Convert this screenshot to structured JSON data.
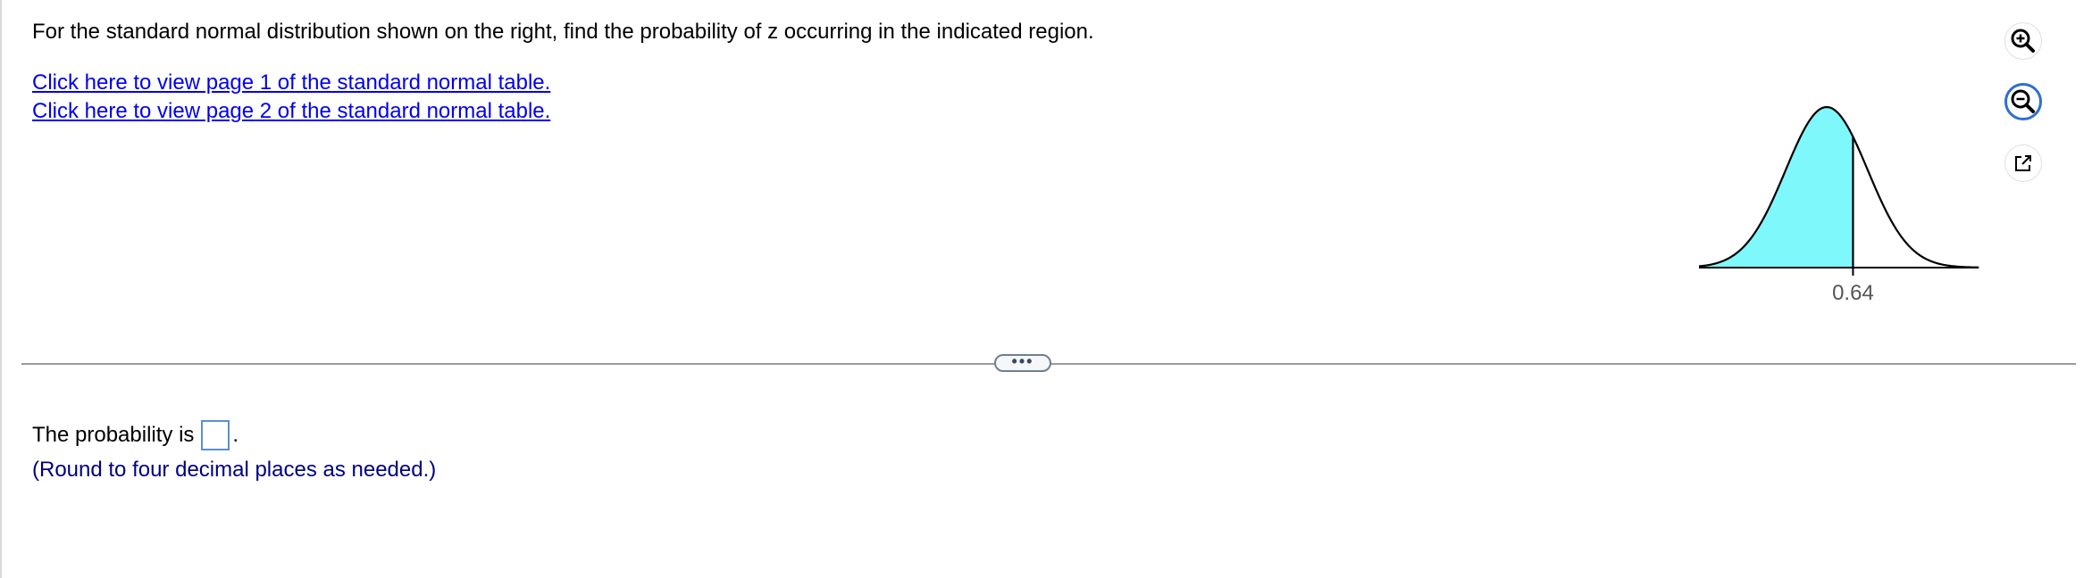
{
  "question": {
    "text": "For the standard normal distribution shown on the right, find the probability of z occurring in the indicated region."
  },
  "links": [
    {
      "label": "Click here to view page 1 of the standard normal table."
    },
    {
      "label": "Click here to view page 2 of the standard normal table."
    }
  ],
  "figure": {
    "z_value_label": "0.64",
    "z_value": 0.64,
    "shaded_region": "left of z",
    "fill_color": "#7ff8fb",
    "curve_color": "#000000"
  },
  "toolbar": {
    "icons": [
      "zoom-in-icon",
      "zoom-out-icon",
      "popout-icon"
    ]
  },
  "divider": {
    "handle_label": "•••"
  },
  "answer": {
    "prefix": "The probability is",
    "suffix": ".",
    "value": "",
    "hint": "(Round to four decimal places as needed.)"
  },
  "colors": {
    "link": "#0000ee",
    "hint": "#000080",
    "input_border": "#5b8fd6",
    "active_tool_border": "#2f6fcf"
  }
}
